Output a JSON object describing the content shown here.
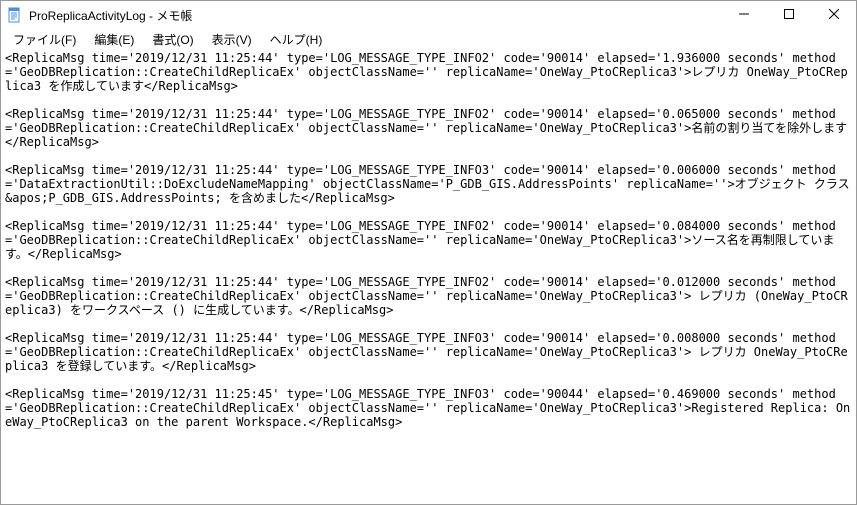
{
  "window": {
    "title": "ProReplicaActivityLog - メモ帳"
  },
  "menu": {
    "file": "ファイル(F)",
    "edit": "編集(E)",
    "format": "書式(O)",
    "view": "表示(V)",
    "help": "ヘルプ(H)"
  },
  "content": "<ReplicaMsg time='2019/12/31 11:25:44' type='LOG_MESSAGE_TYPE_INFO2' code='90014' elapsed='1.936000 seconds' method='GeoDBReplication::CreateChildReplicaEx' objectClassName='' replicaName='OneWay_PtoCReplica3'>レプリカ OneWay_PtoCReplica3 を作成しています</ReplicaMsg>\n\n<ReplicaMsg time='2019/12/31 11:25:44' type='LOG_MESSAGE_TYPE_INFO2' code='90014' elapsed='0.065000 seconds' method='GeoDBReplication::CreateChildReplicaEx' objectClassName='' replicaName='OneWay_PtoCReplica3'>名前の割り当てを除外します</ReplicaMsg>\n\n<ReplicaMsg time='2019/12/31 11:25:44' type='LOG_MESSAGE_TYPE_INFO3' code='90014' elapsed='0.006000 seconds' method='DataExtractionUtil::DoExcludeNameMapping' objectClassName='P_GDB_GIS.AddressPoints' replicaName=''>オブジェクト クラス &apos;P_GDB_GIS.AddressPoints; を含めました</ReplicaMsg>\n\n<ReplicaMsg time='2019/12/31 11:25:44' type='LOG_MESSAGE_TYPE_INFO2' code='90014' elapsed='0.084000 seconds' method='GeoDBReplication::CreateChildReplicaEx' objectClassName='' replicaName='OneWay_PtoCReplica3'>ソース名を再制限しています。</ReplicaMsg>\n\n<ReplicaMsg time='2019/12/31 11:25:44' type='LOG_MESSAGE_TYPE_INFO2' code='90014' elapsed='0.012000 seconds' method='GeoDBReplication::CreateChildReplicaEx' objectClassName='' replicaName='OneWay_PtoCReplica3'> レプリカ (OneWay_PtoCReplica3) をワークスペース () に生成しています。</ReplicaMsg>\n\n<ReplicaMsg time='2019/12/31 11:25:44' type='LOG_MESSAGE_TYPE_INFO3' code='90014' elapsed='0.008000 seconds' method='GeoDBReplication::CreateChildReplicaEx' objectClassName='' replicaName='OneWay_PtoCReplica3'> レプリカ OneWay_PtoCReplica3 を登録しています。</ReplicaMsg>\n\n<ReplicaMsg time='2019/12/31 11:25:45' type='LOG_MESSAGE_TYPE_INFO3' code='90044' elapsed='0.469000 seconds' method='GeoDBReplication::CreateChildReplicaEx' objectClassName='' replicaName='OneWay_PtoCReplica3'>Registered Replica: OneWay_PtoCReplica3 on the parent Workspace.</ReplicaMsg>\n"
}
